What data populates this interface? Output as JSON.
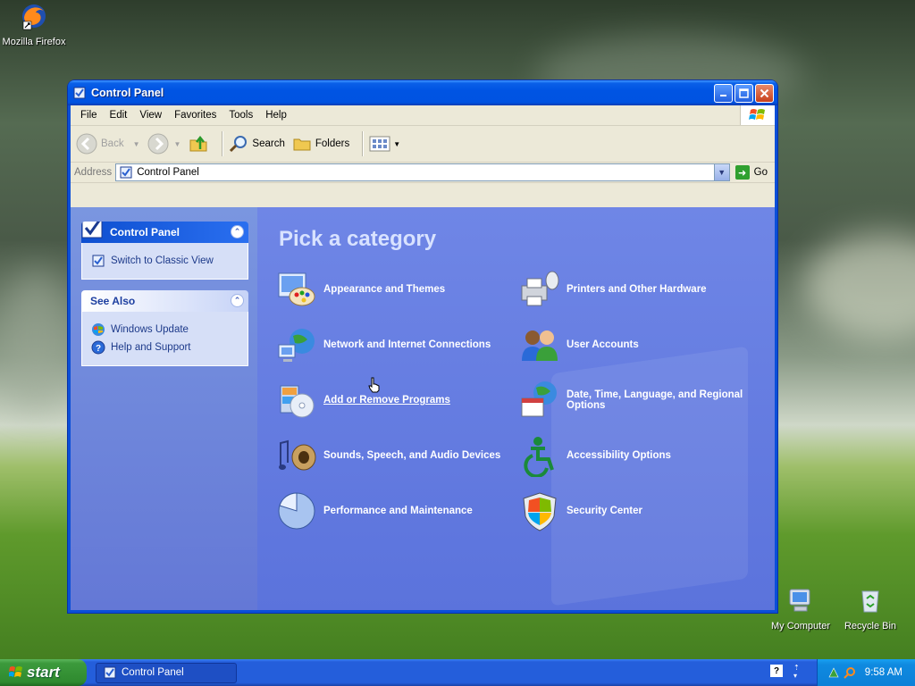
{
  "desktop": {
    "icons": [
      {
        "label": "Mozilla Firefox",
        "icon": "firefox-icon"
      },
      {
        "label": "My Computer",
        "icon": "my-computer-icon"
      },
      {
        "label": "Recycle Bin",
        "icon": "recycle-bin-icon"
      }
    ]
  },
  "window": {
    "title": "Control Panel",
    "menu": [
      "File",
      "Edit",
      "View",
      "Favorites",
      "Tools",
      "Help"
    ],
    "toolbar": {
      "back": "Back",
      "search": "Search",
      "folders": "Folders"
    },
    "address": {
      "label": "Address",
      "value": "Control Panel",
      "go": "Go"
    },
    "sidebar": {
      "main_panel": {
        "title": "Control Panel",
        "links": [
          {
            "label": "Switch to Classic View",
            "icon": "classic-view-icon"
          }
        ]
      },
      "see_also": {
        "title": "See Also",
        "links": [
          {
            "label": "Windows Update",
            "icon": "windows-update-icon"
          },
          {
            "label": "Help and Support",
            "icon": "help-support-icon"
          }
        ]
      }
    },
    "main": {
      "heading": "Pick a category",
      "categories": [
        {
          "label": "Appearance and Themes",
          "icon": "appearance-themes-icon"
        },
        {
          "label": "Printers and Other Hardware",
          "icon": "printers-hardware-icon"
        },
        {
          "label": "Network and Internet Connections",
          "icon": "network-internet-icon"
        },
        {
          "label": "User Accounts",
          "icon": "user-accounts-icon"
        },
        {
          "label": "Add or Remove Programs",
          "icon": "add-remove-programs-icon",
          "hovered": true
        },
        {
          "label": "Date, Time, Language, and Regional Options",
          "icon": "date-time-language-icon"
        },
        {
          "label": "Sounds, Speech, and Audio Devices",
          "icon": "sounds-speech-audio-icon"
        },
        {
          "label": "Accessibility Options",
          "icon": "accessibility-icon"
        },
        {
          "label": "Performance and Maintenance",
          "icon": "performance-maintenance-icon"
        },
        {
          "label": "Security Center",
          "icon": "security-center-icon"
        }
      ]
    }
  },
  "taskbar": {
    "start_label": "start",
    "task_label": "Control Panel",
    "clock": "9:58 AM"
  },
  "colors": {
    "titlebar": "#0054e3",
    "sidebar": "#6478d6",
    "main_bg": "#5b73dc",
    "taskbar": "#245edb",
    "start": "#3c9a3c"
  }
}
